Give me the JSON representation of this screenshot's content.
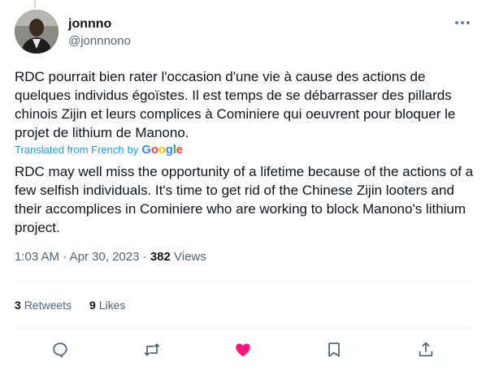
{
  "user": {
    "display_name": "jonnno",
    "handle": "@jonnnono"
  },
  "tweet": {
    "text": "RDC pourrait bien rater l'occasion d'une vie à cause des actions de quelques individus égoïstes. Il est temps de se débarrasser des pillards chinois Zijin et leurs complices à Cominiere qui oeuvrent pour bloquer le projet de lithium de Manono.",
    "translated_label": "Translated from French",
    "by_label": "by",
    "google": [
      "G",
      "o",
      "o",
      "g",
      "l",
      "e"
    ],
    "translation": "RDC may well miss the opportunity of a lifetime because of the actions of a few selfish individuals. It's time to get rid of the Chinese Zijin looters and their accomplices in Cominiere who are working to block Manono's lithium project."
  },
  "meta": {
    "time": "1:03 AM",
    "date": "Apr 30, 2023",
    "separator": "·",
    "views_count": "382",
    "views_label": "Views"
  },
  "stats": {
    "retweets_count": "3",
    "retweets_label": "Retweets",
    "likes_count": "9",
    "likes_label": "Likes"
  },
  "actions": [
    {
      "name": "reply",
      "icon": "reply-icon"
    },
    {
      "name": "retweet",
      "icon": "retweet-icon"
    },
    {
      "name": "like",
      "icon": "heart-icon",
      "active": true
    },
    {
      "name": "bookmark",
      "icon": "bookmark-icon"
    },
    {
      "name": "share",
      "icon": "share-icon"
    }
  ],
  "colors": {
    "text": "#0f1419",
    "secondary": "#536471",
    "link": "#1d9bf0",
    "like_active": "#f91880",
    "divider": "#eff3f4"
  }
}
